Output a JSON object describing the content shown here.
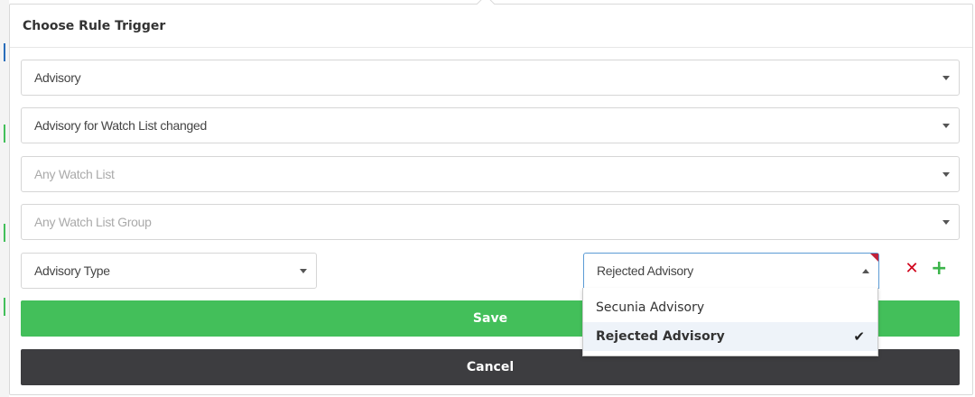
{
  "dialog": {
    "title": "Choose Rule Trigger",
    "selects": {
      "trigger_category": "Advisory",
      "trigger_event": "Advisory for Watch List changed",
      "watch_list_placeholder": "Any Watch List",
      "watch_list_group_placeholder": "Any Watch List Group",
      "condition_field": "Advisory Type",
      "condition_value": "Rejected Advisory"
    },
    "dropdown_options": [
      {
        "label": "Secunia Advisory",
        "selected": false
      },
      {
        "label": "Rejected Advisory",
        "selected": true
      }
    ],
    "buttons": {
      "save": "Save",
      "cancel": "Cancel"
    }
  },
  "icons": {
    "remove": "close-icon",
    "add": "plus-icon",
    "check": "checkmark-icon"
  },
  "colors": {
    "save": "#43bf5a",
    "cancel": "#3d3d40",
    "remove": "#d0021b",
    "add": "#3cb44b",
    "focus_border": "#5b9bd5"
  }
}
